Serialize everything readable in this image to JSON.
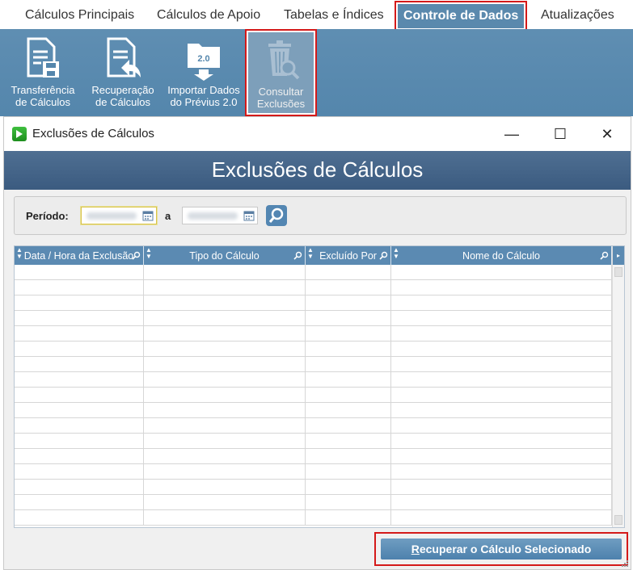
{
  "menu": {
    "items": [
      {
        "label": "Cálculos Principais",
        "active": false
      },
      {
        "label": "Cálculos de Apoio",
        "active": false
      },
      {
        "label": "Tabelas e Índices",
        "active": false
      },
      {
        "label": "Controle de Dados",
        "active": true
      },
      {
        "label": "Atualizações",
        "active": false
      }
    ]
  },
  "ribbon": {
    "buttons": [
      {
        "line1": "Transferência",
        "line2": "de Cálculos",
        "icon": "document-save-icon"
      },
      {
        "line1": "Recuperação",
        "line2": "de Cálculos",
        "icon": "document-undo-icon"
      },
      {
        "line1": "Importar Dados",
        "line2": "do Prévius 2.0",
        "icon": "folder-import-icon"
      },
      {
        "line1": "Consultar",
        "line2": "Exclusões",
        "icon": "trash-search-icon",
        "selected": true
      }
    ]
  },
  "window": {
    "title": "Exclusões de Cálculos",
    "banner": "Exclusões de Cálculos",
    "controls": {
      "minimize": "—",
      "maximize": "☐",
      "close": "✕"
    }
  },
  "filter": {
    "period_label": "Período:",
    "to_label": "a"
  },
  "grid": {
    "columns": [
      "Data / Hora da Exclusão",
      "Tipo do Cálculo",
      "Excluído Por",
      "Nome do Cálculo"
    ],
    "row_count": 17
  },
  "actions": {
    "recover_label_first": "R",
    "recover_label_rest": "ecuperar o Cálculo Selecionado"
  },
  "colors": {
    "accent": "#5a89ad",
    "highlight_border": "#d41919",
    "banner": "#3f5f83"
  }
}
